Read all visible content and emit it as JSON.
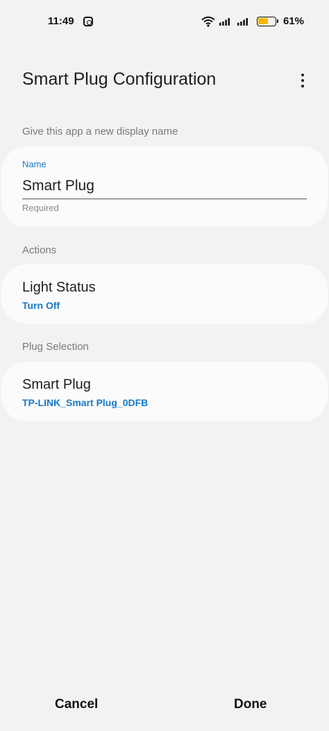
{
  "status_bar": {
    "time": "11:49",
    "battery_percent_text": "61%",
    "battery_level": 0.61,
    "icons": [
      "instagram-icon",
      "wifi-icon",
      "signal-icon",
      "battery-icon"
    ],
    "battery_color": "#f5b800"
  },
  "header": {
    "title": "Smart Plug Configuration",
    "menu_icon": "more-vert-icon"
  },
  "display_name_section": {
    "label": "Give this app a new display name",
    "field_label": "Name",
    "field_value": "Smart Plug",
    "helper_text": "Required"
  },
  "actions_section": {
    "label": "Actions",
    "item_title": "Light Status",
    "item_value": "Turn Off"
  },
  "plug_section": {
    "label": "Plug Selection",
    "item_title": "Smart Plug",
    "item_value": "TP-LINK_Smart Plug_0DFB"
  },
  "footer": {
    "cancel_label": "Cancel",
    "done_label": "Done"
  },
  "colors": {
    "accent": "#1778c9",
    "background": "#f2f2f2",
    "card": "#fbfbfb"
  }
}
